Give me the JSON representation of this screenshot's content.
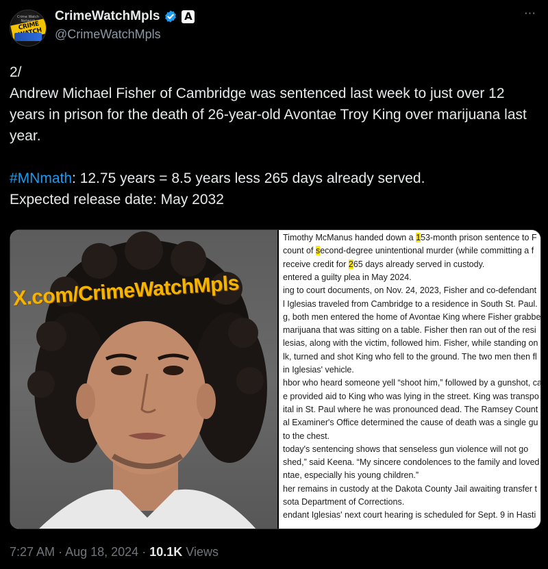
{
  "account": {
    "display_name": "CrimeWatchMpls",
    "handle": "@CrimeWatchMpls",
    "avatar_logo_text": "CRIME WATCH",
    "avatar_top_text": "Crime Watch Network",
    "affiliation_badge": "A",
    "verified_color": "#1d9bf0",
    "more_label": "···"
  },
  "tweet": {
    "text_intro": "2/\nAndrew Michael Fisher of Cambridge was sentenced last week to just over 12 years in prison for the death of 26-year-old Avontae Troy King over marijuana last year.\n\n",
    "hashtag": "#MNmath",
    "text_after_hashtag": ": 12.75 years = 8.5 years less 265 days already served.\nExpected release date: May 2032"
  },
  "media": {
    "watermark": "X.com/CrimeWatchMpls",
    "doc_lines": [
      {
        "pre": "Timothy McManus handed down a ",
        "hl": "1",
        "post": "53-month prison sentence to F"
      },
      {
        "pre": " count of ",
        "hl": "s",
        "post": "econd-degree unintentional murder (while committing a f"
      },
      {
        "pre": " receive credit for ",
        "hl": "2",
        "post": "65 days already served in custody."
      },
      {
        "pre": "entered a guilty plea in May 2024.",
        "hl": "",
        "post": ""
      },
      {
        "pre": "ing to court documents, on Nov. 24, 2023, Fisher and co-defendant",
        "hl": "",
        "post": ""
      },
      {
        "pre": "l Iglesias traveled from Cambridge to a residence in South St. Paul.",
        "hl": "",
        "post": ""
      },
      {
        "pre": "g, both men entered the home of Avontae King where Fisher grabbe",
        "hl": "",
        "post": ""
      },
      {
        "pre": " marijuana that was sitting on a table. Fisher then ran out of the resi",
        "hl": "",
        "post": ""
      },
      {
        "pre": "lesias, along with the victim, followed him. Fisher, while standing on",
        "hl": "",
        "post": ""
      },
      {
        "pre": "lk, turned and shot King who fell to the ground. The two men then fl",
        "hl": "",
        "post": ""
      },
      {
        "pre": "in Iglesias' vehicle.",
        "hl": "",
        "post": ""
      },
      {
        "pre": "hbor who heard someone yell “shoot him,” followed by a gunshot, ca",
        "hl": "",
        "post": ""
      },
      {
        "pre": "e provided aid to King who was lying in the street. King was transpo",
        "hl": "",
        "post": ""
      },
      {
        "pre": "ital in St. Paul where he was pronounced dead. The Ramsey Count",
        "hl": "",
        "post": ""
      },
      {
        "pre": "al Examiner's Office determined the cause of death was a single gu",
        "hl": "",
        "post": ""
      },
      {
        "pre": " to the chest.",
        "hl": "",
        "post": ""
      },
      {
        "pre": " today's sentencing shows that senseless gun violence will not go",
        "hl": "",
        "post": ""
      },
      {
        "pre": "shed,” said Keena. “My sincere condolences to the family and loved",
        "hl": "",
        "post": ""
      },
      {
        "pre": "ntae, especially his young children.”",
        "hl": "",
        "post": ""
      },
      {
        "pre": "her remains in custody at the Dakota County Jail awaiting transfer t",
        "hl": "",
        "post": ""
      },
      {
        "pre": "sota Department of Corrections.",
        "hl": "",
        "post": ""
      },
      {
        "pre": "endant Iglesias' next court hearing is scheduled for Sept. 9 in Hasti",
        "hl": "",
        "post": ""
      }
    ]
  },
  "meta": {
    "time": "7:27 AM",
    "sep1": "·",
    "date": "Aug 18, 2024",
    "sep2": "·",
    "views_count": "10.1K",
    "views_label": "Views"
  },
  "colors": {
    "background": "#000000",
    "text": "#e7e9ea",
    "muted": "#71767b",
    "link": "#1d9bf0",
    "highlight": "#ffe600"
  }
}
